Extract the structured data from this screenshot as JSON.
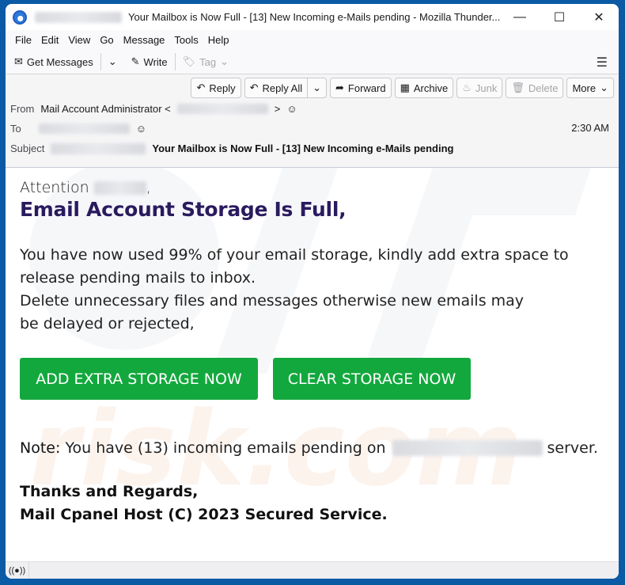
{
  "window": {
    "title": "Your Mailbox is Now Full - [13] New Incoming e-Mails pending - Mozilla Thunder...",
    "controls": [
      "minimize",
      "maximize",
      "close"
    ]
  },
  "menu": [
    "File",
    "Edit",
    "View",
    "Go",
    "Message",
    "Tools",
    "Help"
  ],
  "toolbar": {
    "get_messages": "Get Messages",
    "write": "Write",
    "tag": "Tag"
  },
  "actions": {
    "reply": "Reply",
    "reply_all": "Reply All",
    "forward": "Forward",
    "archive": "Archive",
    "junk": "Junk",
    "delete": "Delete",
    "more": "More"
  },
  "header": {
    "from_label": "From",
    "from_name": "Mail Account Administrator <",
    "from_close": ">",
    "to_label": "To",
    "subject_label": "Subject",
    "subject": "Your Mailbox is Now Full - [13] New Incoming e-Mails pending",
    "time": "2:30 AM"
  },
  "body": {
    "attention": "Attention",
    "attention_suffix": ",",
    "headline": "Email Account Storage Is Full,",
    "para1": "You have now used 99% of your email storage, kindly add extra space to release pending mails to inbox.",
    "para2": "Delete unnecessary files and messages otherwise new emails may be delayed or rejected,",
    "button_add": "ADD EXTRA STORAGE NOW",
    "button_clear": "CLEAR STORAGE NOW",
    "note_label": "Note:",
    "note_text": "You have (13) incoming emails pending on",
    "note_suffix": "server.",
    "sign_line1": "Thanks and Regards,",
    "sign_line2": "Mail Cpanel Host (C) 2023 Secured Service."
  },
  "colors": {
    "frame": "#0b5aa5",
    "headline": "#2a1a5e",
    "cta": "#13a83d"
  }
}
